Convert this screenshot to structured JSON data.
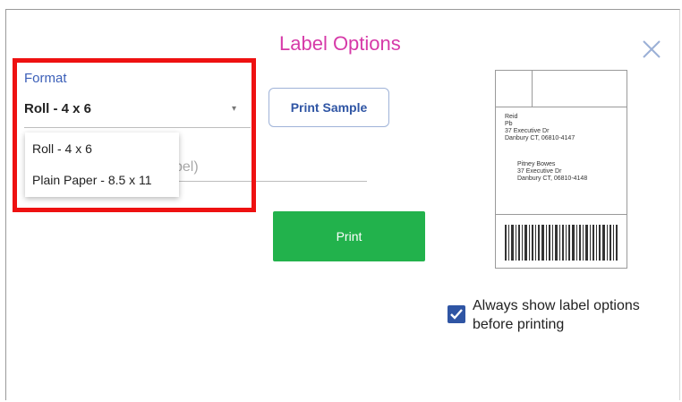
{
  "dialog": {
    "title": "Label Options",
    "close_icon": "close-icon"
  },
  "format": {
    "label": "Format",
    "selected": "Roll - 4 x 6",
    "options": [
      "Roll - 4 x 6",
      "Plain Paper - 8.5 x 11"
    ]
  },
  "partially_hidden_field": {
    "visible_text": "bel)"
  },
  "buttons": {
    "print_sample": "Print Sample",
    "print": "Print"
  },
  "preview": {
    "from_lines": [
      "Reid",
      "Pb",
      "37 Executive Dr",
      "Danbury CT, 06810-4147"
    ],
    "to_lines": [
      "Pitney Bowes",
      "37 Executive Dr",
      "Danbury CT, 06810-4148"
    ]
  },
  "always_show": {
    "checked": true,
    "label_line1": "Always show label options",
    "label_line2": "before printing"
  },
  "colors": {
    "title": "#d63aa8",
    "accent": "#2f55a4",
    "print_button": "#22b24c",
    "highlight_box": "#ee1111"
  }
}
